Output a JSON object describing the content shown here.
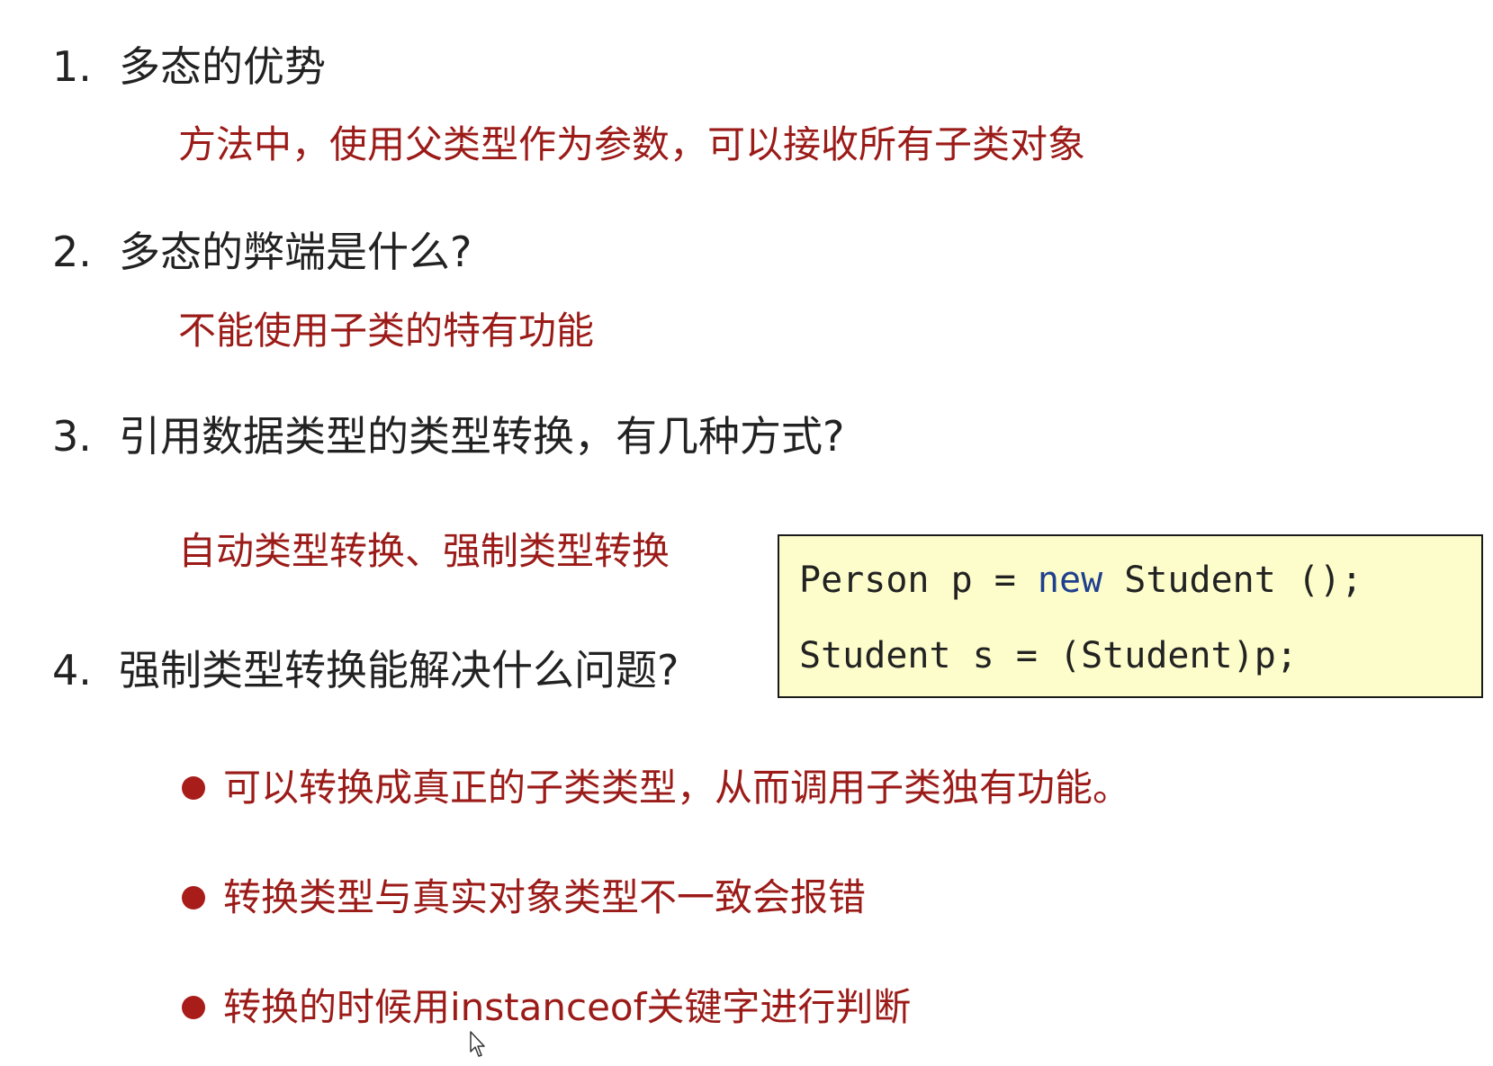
{
  "questions": [
    {
      "num": "1.",
      "text": "多态的优势"
    },
    {
      "num": "2.",
      "text": "多态的弊端是什么?"
    },
    {
      "num": "3.",
      "text": "引用数据类型的类型转换，有几种方式?"
    },
    {
      "num": "4.",
      "text": "强制类型转换能解决什么问题?"
    }
  ],
  "answers": {
    "a1": "方法中，使用父类型作为参数，可以接收所有子类对象",
    "a2": "不能使用子类的特有功能",
    "a3": "自动类型转换、强制类型转换"
  },
  "bullets": [
    "可以转换成真正的子类类型，从而调用子类独有功能。",
    "转换类型与真实对象类型不一致会报错",
    "转换的时候用instanceof关键字进行判断"
  ],
  "code": {
    "line1_before": "Person p = ",
    "line1_keyword": "new",
    "line1_after": " Student ();",
    "line2": "Student s = (Student)p;"
  },
  "colors": {
    "answer_red": "#9b1b18",
    "code_background": "#fdfdcb",
    "keyword_blue": "#1f3f8f"
  }
}
